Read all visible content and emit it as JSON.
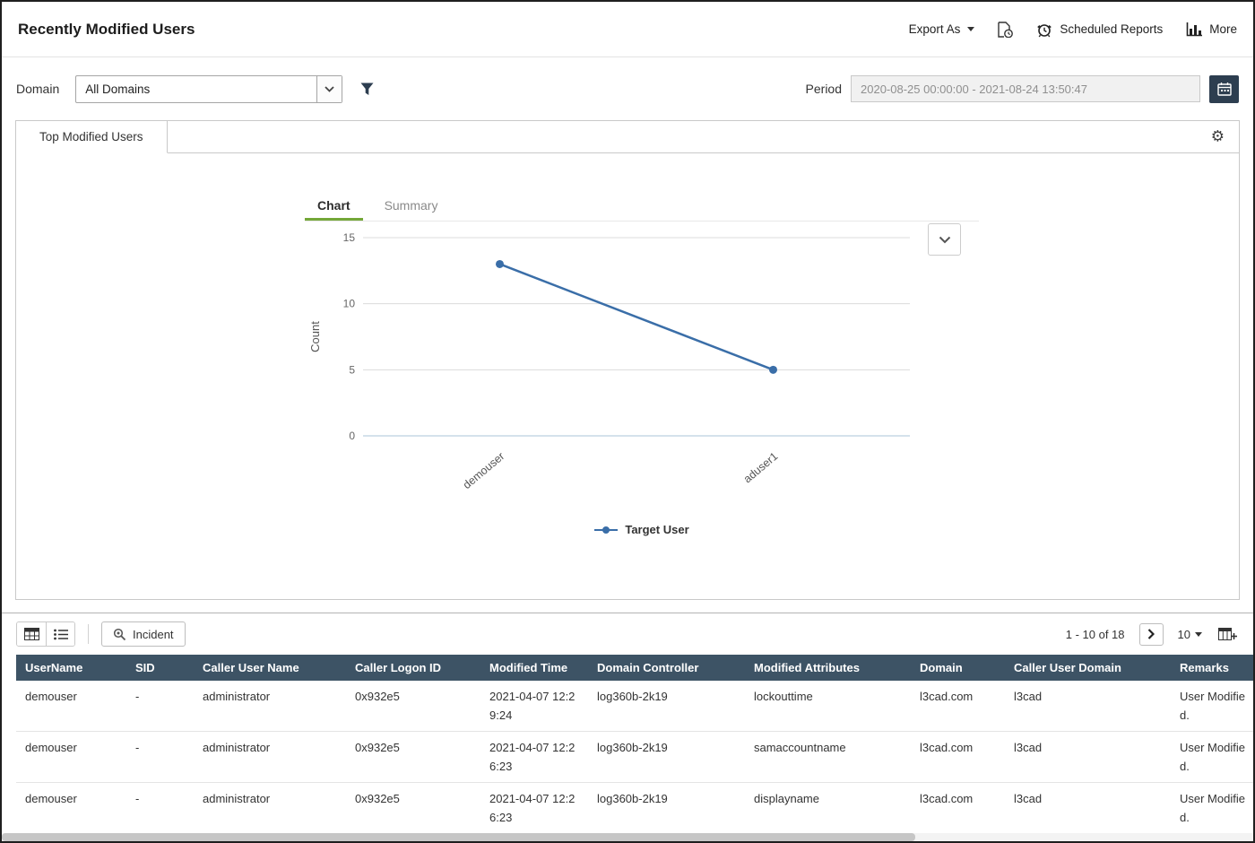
{
  "page": {
    "title": "Recently Modified Users"
  },
  "header": {
    "export_as_label": "Export As",
    "scheduled_reports_label": "Scheduled Reports",
    "more_label": "More"
  },
  "filters": {
    "domain_label": "Domain",
    "domain_selected": "All Domains",
    "period_label": "Period",
    "period_value": "2020-08-25 00:00:00 - 2021-08-24 13:50:47"
  },
  "panel": {
    "tab_label": "Top Modified Users",
    "view_tabs": {
      "chart": "Chart",
      "summary": "Summary"
    }
  },
  "chart_data": {
    "type": "line",
    "title": "",
    "categories": [
      "demouser",
      "aduser1"
    ],
    "series": [
      {
        "name": "Target User",
        "values": [
          13,
          5
        ]
      }
    ],
    "xlabel": "",
    "ylabel": "Count",
    "ylim": [
      0,
      15
    ],
    "yticks": [
      0,
      5,
      10,
      15
    ],
    "grid": true,
    "legend_position": "bottom",
    "line_color": "#3a6ea8",
    "x_label_rotation": -40
  },
  "table": {
    "toolbar": {
      "incident_label": "Incident",
      "pagination_info": "1 - 10 of 18",
      "page_size": "10"
    },
    "columns": [
      "UserName",
      "SID",
      "Caller User Name",
      "Caller Logon ID",
      "Modified Time",
      "Domain Controller",
      "Modified Attributes",
      "Domain",
      "Caller User Domain",
      "Remarks"
    ],
    "rows": [
      [
        "demouser",
        "-",
        "administrator",
        "0x932e5",
        "2021-04-07 12:29:24",
        "log360b-2k19",
        "lockouttime",
        "l3cad.com",
        "l3cad",
        "User Modified."
      ],
      [
        "demouser",
        "-",
        "administrator",
        "0x932e5",
        "2021-04-07 12:26:23",
        "log360b-2k19",
        "samaccountname",
        "l3cad.com",
        "l3cad",
        "User Modified."
      ],
      [
        "demouser",
        "-",
        "administrator",
        "0x932e5",
        "2021-04-07 12:26:23",
        "log360b-2k19",
        "displayname",
        "l3cad.com",
        "l3cad",
        "User Modified."
      ]
    ]
  },
  "icons": {
    "gear": "⚙"
  },
  "colors": {
    "accent_green": "#74a738",
    "chart_blue": "#3a6ea8",
    "table_header_bg": "#3d5365",
    "calendar_button_bg": "#2d3e50"
  }
}
